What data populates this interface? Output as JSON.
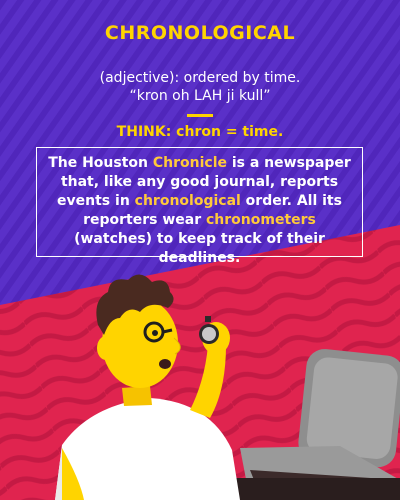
{
  "word": "CHRONOLOGICAL",
  "part_of_speech": "(adjective): ordered by time.",
  "pronunciation": "“kron oh LAH ji kull”",
  "think": "THINK: chron = time.",
  "example": {
    "t1": "The Houston ",
    "h1": "Chronicle",
    "t2": " is a newspaper that, like any good journal, reports events in ",
    "h2": "chronological",
    "t3": " order. All its reporters wear ",
    "h3": "chronometers",
    "t4": " (watches) to keep track of their deadlines."
  },
  "colors": {
    "purple": "#5a30c8",
    "red": "#e0244f",
    "yellow": "#ffd400",
    "highlight": "#ffc93a",
    "divider": "#ffd400"
  },
  "icons": {
    "character": "person-with-stopwatch",
    "laptop": "laptop-icon"
  }
}
